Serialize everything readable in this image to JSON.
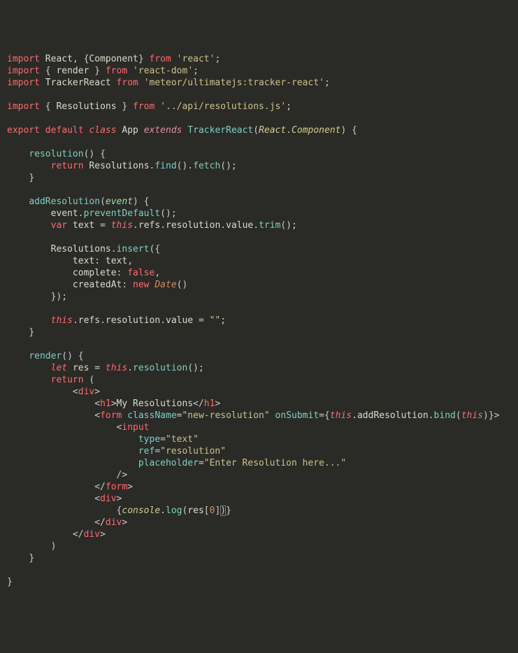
{
  "tokens": {
    "l1": {
      "import": "import",
      "React": "React",
      "Component": "Component",
      "from": "from",
      "str": "'react'"
    },
    "l2": {
      "import": "import",
      "render": "render",
      "from": "from",
      "str": "'react-dom'"
    },
    "l3": {
      "import": "import",
      "TrackerReact": "TrackerReact",
      "from": "from",
      "str": "'meteor/ultimatejs:tracker-react'"
    },
    "l4": {
      "import": "import",
      "Resolutions": "Resolutions",
      "from": "from",
      "str": "'../api/resolutions.js'"
    },
    "l5": {
      "export": "export",
      "default": "default",
      "class": "class",
      "App": "App",
      "extends": "extends",
      "TrackerReact": "TrackerReact",
      "React": "React",
      "Component": "Component"
    },
    "l6": {
      "resolution": "resolution"
    },
    "l7": {
      "return": "return",
      "Resolutions": "Resolutions",
      "find": "find",
      "fetch": "fetch"
    },
    "l8": {
      "addResolution": "addResolution",
      "event": "event"
    },
    "l9": {
      "ev": "event",
      "pd": "preventDefault"
    },
    "l10": {
      "var": "var",
      "text": "text",
      "this": "this",
      "refs": "refs",
      "resolution": "resolution",
      "value": "value",
      "trim": "trim"
    },
    "l11": {
      "Resolutions": "Resolutions",
      "insert": "insert"
    },
    "l12": {
      "textk": "text",
      "textv": "text"
    },
    "l13": {
      "completek": "complete",
      "false": "false"
    },
    "l14": {
      "createdAtk": "createdAt",
      "new": "new",
      "Date": "Date"
    },
    "l15": {
      "this": "this",
      "refs": "refs",
      "resolution": "resolution",
      "value": "value",
      "empty": "\"\""
    },
    "l16": {
      "render": "render"
    },
    "l17": {
      "let": "let",
      "res": "res",
      "this": "this",
      "resolution": "resolution"
    },
    "l18": {
      "return": "return"
    },
    "l19": {
      "div": "div"
    },
    "l20": {
      "h1": "h1",
      "text": "My Resolutions"
    },
    "l21": {
      "form": "form",
      "className": "className",
      "classVal": "\"new-resolution\"",
      "onSubmit": "onSubmit",
      "this": "this",
      "addResolution": "addResolution",
      "bind": "bind"
    },
    "l22": {
      "input": "input"
    },
    "l23": {
      "type": "type",
      "typeVal": "\"text\""
    },
    "l24": {
      "ref": "ref",
      "refVal": "\"resolution\""
    },
    "l25": {
      "placeholder": "placeholder",
      "phVal": "\"Enter Resolution here...\""
    },
    "l26": {
      "slashGt": "/>"
    },
    "l27": {
      "endform": "form"
    },
    "l28": {
      "div": "div"
    },
    "l29": {
      "console": "console",
      "log": "log",
      "res": "res",
      "zero": "0"
    },
    "l30": {
      "enddiv": "div"
    },
    "l31": {
      "enddiv": "div"
    }
  }
}
